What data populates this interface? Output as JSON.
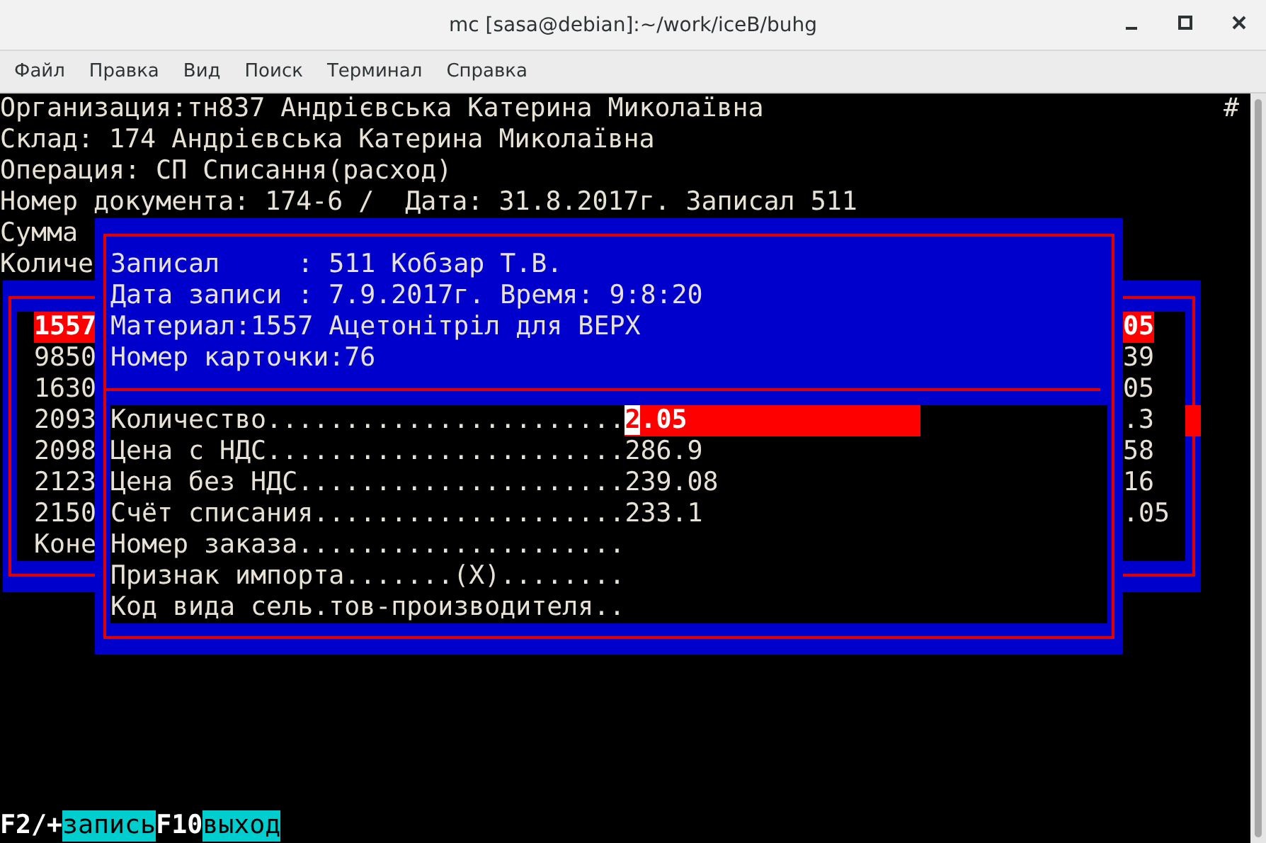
{
  "window": {
    "title": "mc [sasa@debian]:~/work/iceB/buhg"
  },
  "menu": [
    {
      "label": "Файл"
    },
    {
      "label": "Правка"
    },
    {
      "label": "Вид"
    },
    {
      "label": "Поиск"
    },
    {
      "label": "Терминал"
    },
    {
      "label": "Справка"
    }
  ],
  "header_lines": [
    "Организация:тн837 Андрієвська Катерина Миколаївна",
    "Склад: 174 Андрієвська Катерина Миколаївна",
    "Операция: СП Списання(расход)",
    "Номер документа: 174-6 /  Дата: 31.8.2017г. Записал 511",
    "Сумма",
    "Количе"
  ],
  "corner_mark": "#",
  "list_panel": {
    "rows": [
      {
        "code": "1557",
        "value": "05",
        "selected": true
      },
      {
        "code": "9850",
        "value": "39",
        "selected": false
      },
      {
        "code": "1630",
        "value": "05",
        "selected": false
      },
      {
        "code": "2093",
        "value": ".3",
        "selected": false
      },
      {
        "code": "2098",
        "value": "58",
        "selected": false
      },
      {
        "code": "2123",
        "value": "16",
        "selected": false
      },
      {
        "code": "2150",
        "value": ".05",
        "selected": false
      },
      {
        "code": "Коне",
        "selected": false
      }
    ]
  },
  "dialog": {
    "info_lines": [
      "Записал     : 511 Кобзар Т.В.",
      "Дата записи : 7.9.2017г. Время: 9:8:20",
      "Материал:1557 Ацетонітріл для ВЕРХ",
      "Номер карточки:76"
    ],
    "fields": [
      {
        "label": "Количество.......................",
        "value": "2.05",
        "selected": true
      },
      {
        "label": "Цена с НДС.......................",
        "value": "286.9",
        "selected": false
      },
      {
        "label": "Цена без НДС.....................",
        "value": "239.08",
        "selected": false
      },
      {
        "label": "Счёт списания....................",
        "value": "233.1",
        "selected": false
      },
      {
        "label": "Номер заказа.....................",
        "selected": false
      },
      {
        "label": "Признак импорта.......(X)........",
        "selected": false
      },
      {
        "label": "Код вида сель.тов-производителя..",
        "selected": false
      }
    ]
  },
  "key_hints": [
    {
      "key": "F2/+",
      "action": "запись"
    },
    {
      "key": "F10",
      "action": "выход"
    }
  ]
}
